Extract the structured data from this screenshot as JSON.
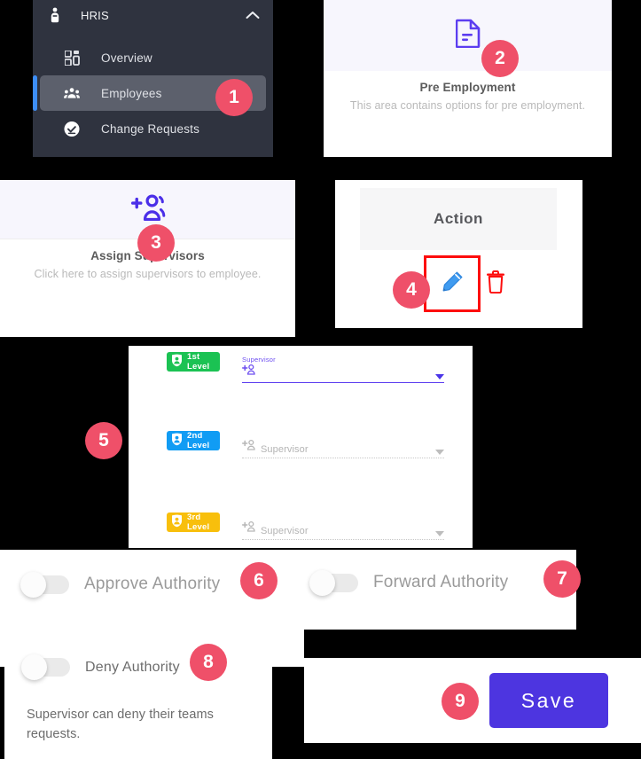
{
  "sidebar": {
    "header": {
      "label": "HRIS",
      "icon": "user-badge-icon",
      "chevron": "chevron-up-icon"
    },
    "items": [
      {
        "label": "Overview",
        "icon": "grid-icon",
        "active": false
      },
      {
        "label": "Employees",
        "icon": "people-icon",
        "active": true
      },
      {
        "label": "Change Requests",
        "icon": "check-circle-icon",
        "active": false
      }
    ]
  },
  "pre_employment_card": {
    "icon": "document-icon",
    "title": "Pre Employment",
    "subtitle": "This area contains options for pre employment."
  },
  "assign_supervisors_card": {
    "icon": "add-person-icon",
    "title": "Assign Supervisors",
    "subtitle": "Click here to assign supervisors to employee."
  },
  "action_column": {
    "header": "Action",
    "edit_icon": "pencil-icon",
    "delete_icon": "trash-icon"
  },
  "supervisor_levels": {
    "rows": [
      {
        "level_label": "1st Level",
        "color": "#1bc253",
        "caption": "Supervisor",
        "value": "",
        "placeholder": "Supervisor",
        "focused": true
      },
      {
        "level_label": "2nd Level",
        "color": "#119cf4",
        "caption": "",
        "value": "",
        "placeholder": "Supervisor",
        "focused": false
      },
      {
        "level_label": "3rd Level",
        "color": "#f8bf0c",
        "caption": "",
        "value": "",
        "placeholder": "Supervisor",
        "focused": false
      }
    ],
    "person_icon": "add-person-icon",
    "dropdown_icon": "caret-down-icon"
  },
  "toggles": {
    "approve": {
      "label": "Approve Authority",
      "state": "off"
    },
    "forward": {
      "label": "Forward Authority",
      "state": "off"
    },
    "deny": {
      "label": "Deny Authority",
      "state": "off",
      "description": "Supervisor can deny their teams requests."
    }
  },
  "save": {
    "label": "Save",
    "color": "#4d35e0"
  },
  "callouts": {
    "one": "1",
    "two": "2",
    "three": "3",
    "four": "4",
    "five": "5",
    "six": "6",
    "seven": "7",
    "eight": "8",
    "nine": "9"
  }
}
